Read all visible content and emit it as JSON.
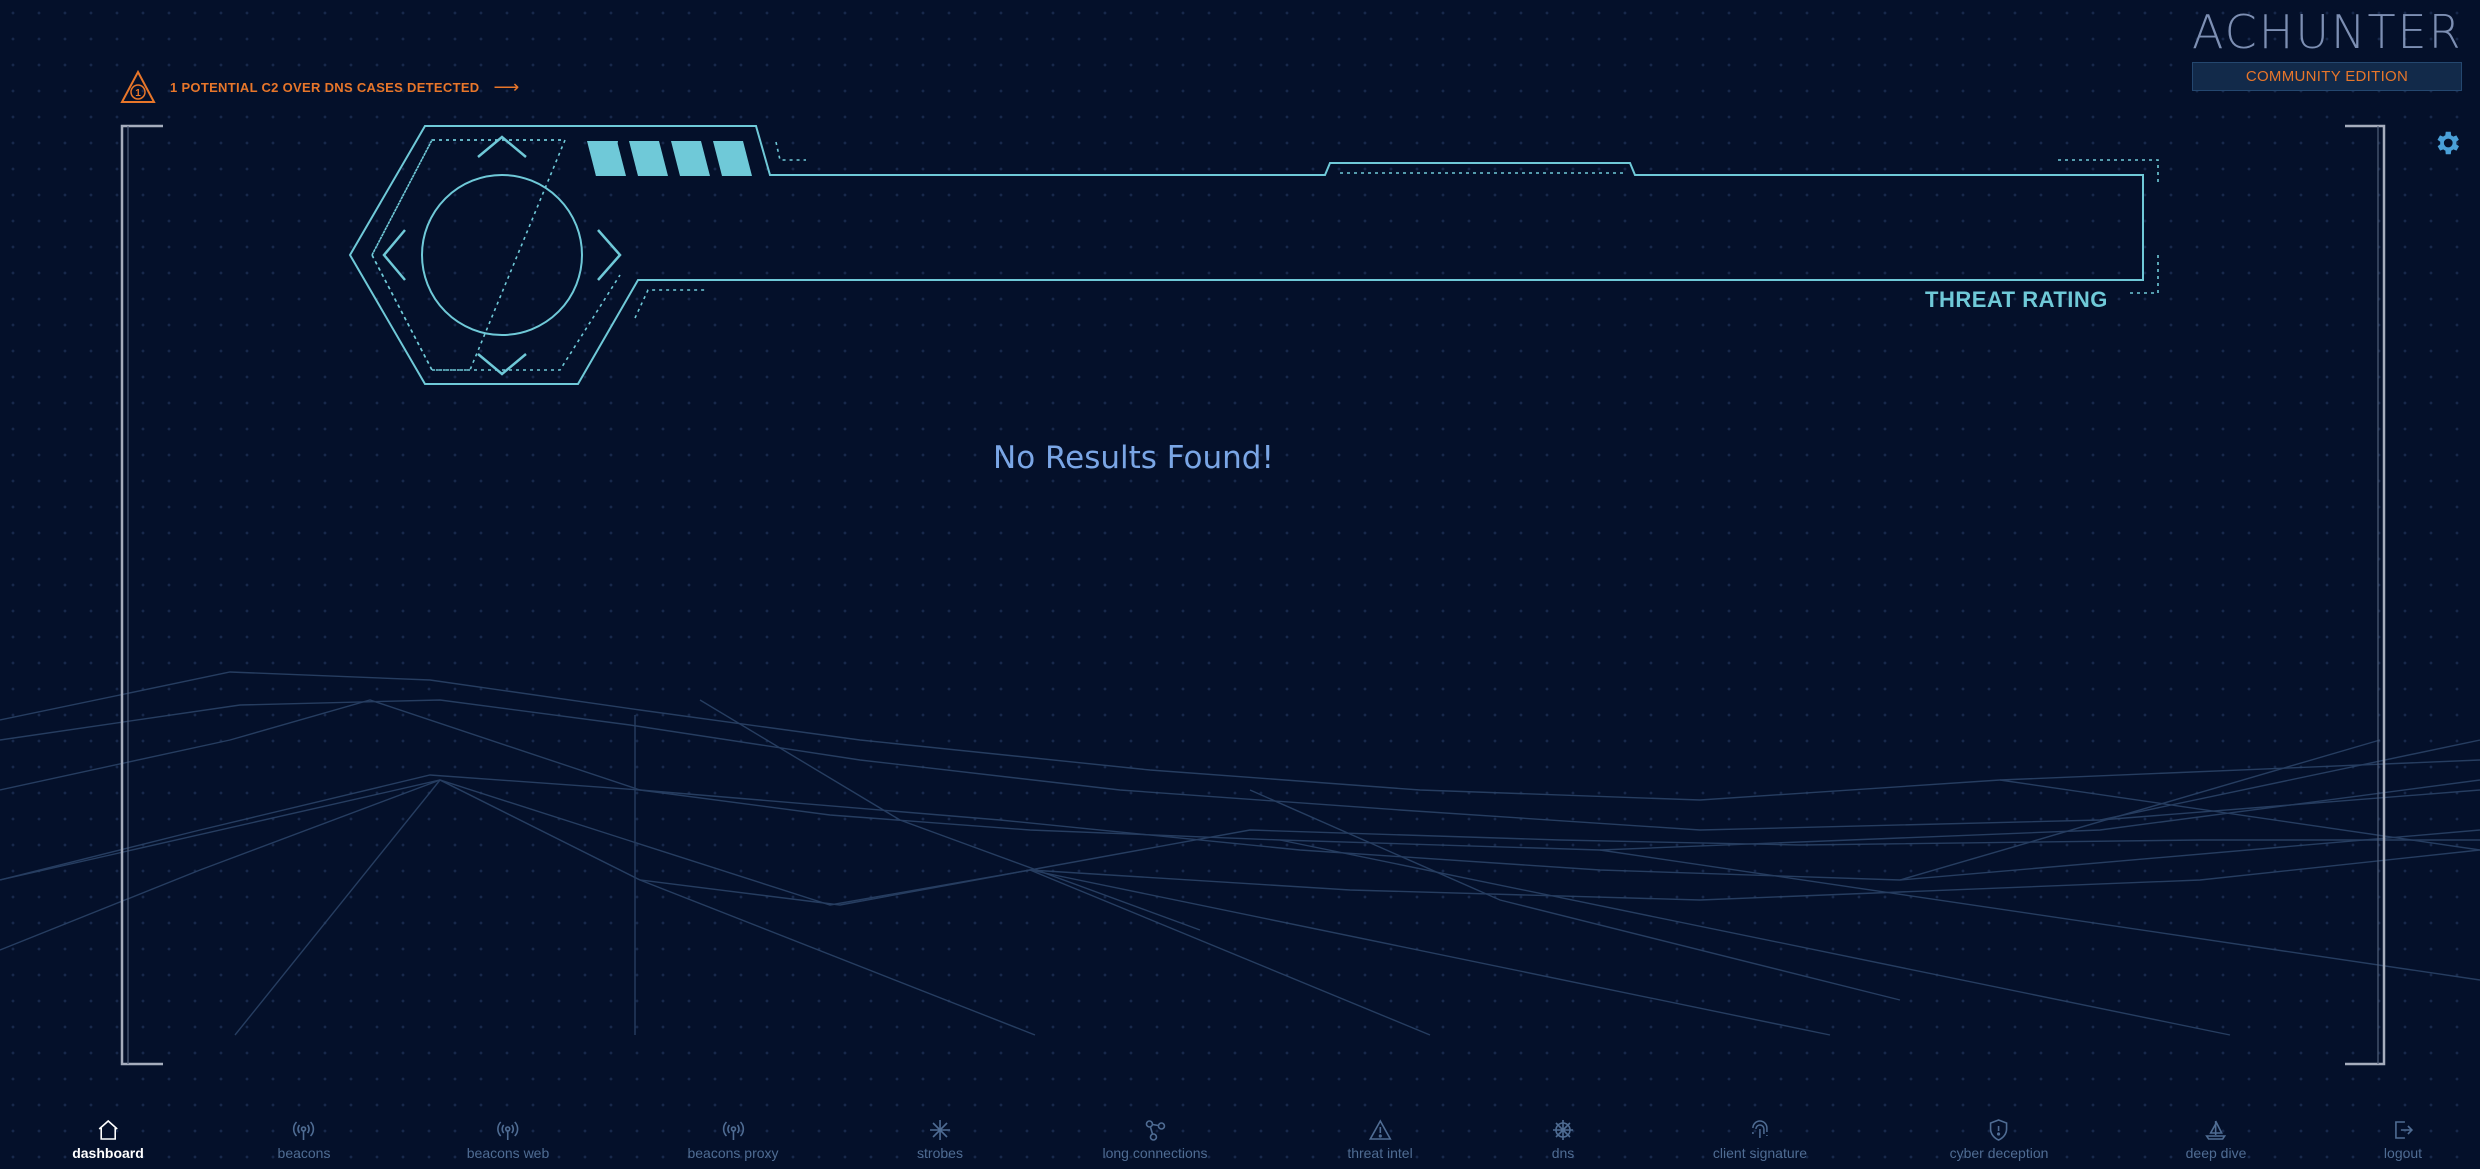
{
  "alert": {
    "text": "1 POTENTIAL C2 OVER DNS CASES DETECTED",
    "icon": "warning-triangle-icon",
    "color": "#e8762a"
  },
  "logo": {
    "left": "AC",
    "right": "HUNTER",
    "edition": "COMMUNITY EDITION"
  },
  "panel": {
    "threat_label": "THREAT RATING",
    "rating_bars": 4
  },
  "main": {
    "empty_message": "No Results Found!"
  },
  "colors": {
    "background": "#04102a",
    "accent_cyan": "#6fc9d8",
    "accent_orange": "#e8762a",
    "frame": "#9aa3b5"
  },
  "nav": {
    "items": [
      {
        "label": "dashboard",
        "icon": "home-icon",
        "active": true
      },
      {
        "label": "beacons",
        "icon": "broadcast-icon"
      },
      {
        "label": "beacons web",
        "icon": "broadcast-icon"
      },
      {
        "label": "beacons proxy",
        "icon": "broadcast-icon"
      },
      {
        "label": "strobes",
        "icon": "burst-icon"
      },
      {
        "label": "long connections",
        "icon": "network-nodes-icon"
      },
      {
        "label": "threat intel",
        "icon": "warning-triangle-icon"
      },
      {
        "label": "dns",
        "icon": "globe-net-icon"
      },
      {
        "label": "client signature",
        "icon": "fingerprint-icon"
      },
      {
        "label": "cyber deception",
        "icon": "shield-icon"
      },
      {
        "label": "deep dive",
        "icon": "sailboat-icon"
      },
      {
        "label": "logout",
        "icon": "logout-icon"
      }
    ]
  }
}
